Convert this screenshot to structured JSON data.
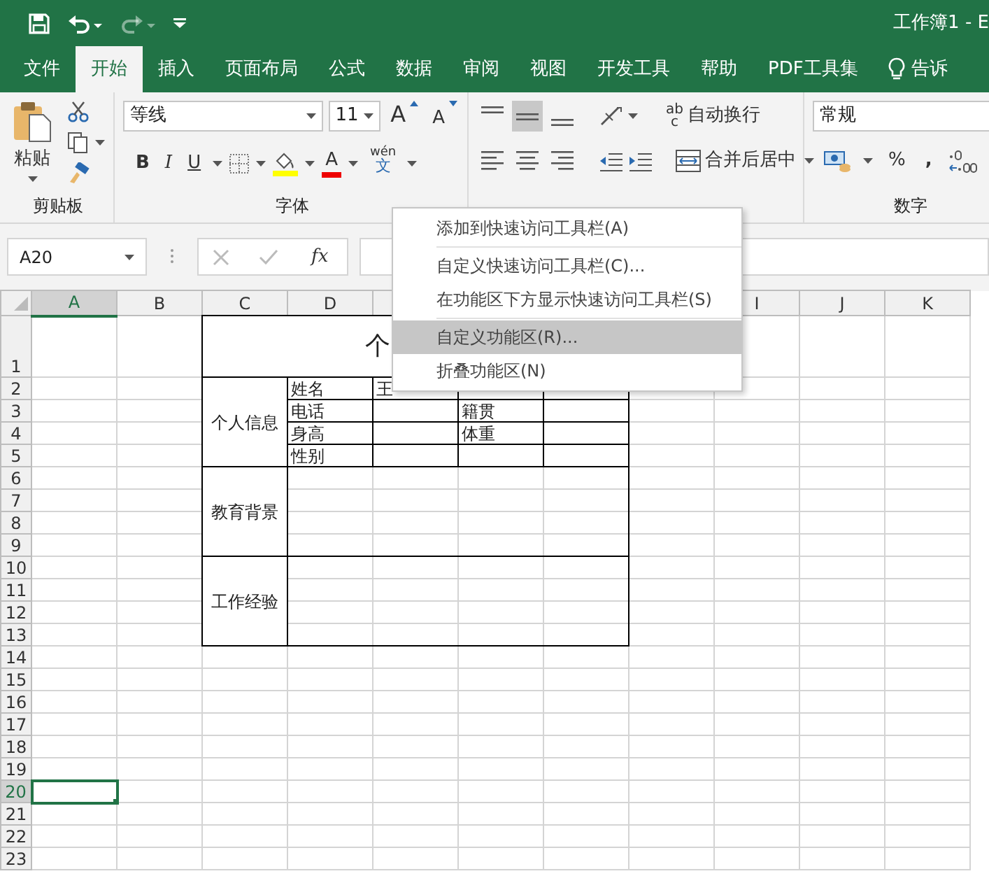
{
  "title_bar": {
    "quick_access": [
      {
        "kind": "save",
        "disabled": false
      },
      {
        "kind": "undo",
        "disabled": false
      },
      {
        "kind": "redo",
        "disabled": true
      },
      {
        "kind": "customize",
        "disabled": false
      }
    ],
    "title": "工作簿1 - E"
  },
  "tabs": [
    {
      "label": "文件",
      "selected": false
    },
    {
      "label": "开始",
      "selected": true
    },
    {
      "label": "插入",
      "selected": false
    },
    {
      "label": "页面布局",
      "selected": false
    },
    {
      "label": "公式",
      "selected": false
    },
    {
      "label": "数据",
      "selected": false
    },
    {
      "label": "审阅",
      "selected": false
    },
    {
      "label": "视图",
      "selected": false
    },
    {
      "label": "开发工具",
      "selected": false
    },
    {
      "label": "帮助",
      "selected": false
    },
    {
      "label": "PDF工具集",
      "selected": false
    },
    {
      "label": "告诉",
      "selected": false,
      "kind": "tell"
    }
  ],
  "ribbon": {
    "clipboard": {
      "paste": "粘贴",
      "label": "剪贴板"
    },
    "font": {
      "family": "等线",
      "size": "11",
      "grow": "A",
      "shrink": "A",
      "bold": "B",
      "italic": "I",
      "underline": "U",
      "font_color": "A",
      "phonetic_top": "wén",
      "phonetic_bottom": "文",
      "label": "字体"
    },
    "alignment": {
      "vertical": [
        {
          "kind": "top",
          "selected": false
        },
        {
          "kind": "middle",
          "selected": true
        },
        {
          "kind": "bottom",
          "selected": false
        }
      ],
      "horizontal": [
        {
          "kind": "left",
          "selected": false
        },
        {
          "kind": "center",
          "selected": false
        },
        {
          "kind": "right",
          "selected": false
        }
      ],
      "wrap_icon_top": "ab",
      "wrap_icon_bottom": "c",
      "wrap": "自动换行",
      "merge": "合并后居中"
    },
    "number": {
      "format": "常规",
      "percent": "%",
      "comma": ",",
      "label": "数字"
    }
  },
  "formula_bar": {
    "name_box": "A20",
    "function": "fx"
  },
  "sheet": {
    "columns": [
      {
        "label": "A",
        "selected": true
      },
      {
        "label": "B",
        "selected": false
      },
      {
        "label": "C",
        "selected": false
      },
      {
        "label": "D",
        "selected": false
      },
      {},
      {},
      {},
      {},
      {
        "label": "I",
        "selected": false
      },
      {
        "label": "J",
        "selected": false
      },
      {
        "label": "K",
        "selected": false
      }
    ],
    "rows": [
      {
        "label": "1",
        "selected": false
      },
      {
        "label": "2",
        "selected": false
      },
      {
        "label": "3",
        "selected": false
      },
      {
        "label": "4",
        "selected": false
      },
      {
        "label": "5",
        "selected": false
      },
      {
        "label": "6",
        "selected": false
      },
      {
        "label": "7",
        "selected": false
      },
      {
        "label": "8",
        "selected": false
      },
      {
        "label": "9",
        "selected": false
      },
      {
        "label": "10",
        "selected": false
      },
      {
        "label": "11",
        "selected": false
      },
      {
        "label": "12",
        "selected": false
      },
      {
        "label": "13",
        "selected": false
      },
      {
        "label": "14",
        "selected": false
      },
      {
        "label": "15",
        "selected": false
      },
      {
        "label": "16",
        "selected": false
      },
      {
        "label": "17",
        "selected": false
      },
      {
        "label": "18",
        "selected": false
      },
      {
        "label": "19",
        "selected": false
      },
      {
        "label": "20",
        "selected": true
      },
      {
        "label": "21",
        "selected": false
      },
      {
        "label": "22",
        "selected": false
      },
      {
        "label": "23",
        "selected": false
      }
    ],
    "form": {
      "title": "个",
      "sections": [
        {
          "label": "个人信息",
          "fields": [
            {
              "label": "姓名",
              "value": "王"
            },
            {
              "label": "电话",
              "label_2": "籍贯"
            },
            {
              "label": "身高",
              "label_2": "体重"
            },
            {
              "label": "性别"
            }
          ]
        },
        {
          "label": "教育背景"
        },
        {
          "label": "工作经验"
        }
      ]
    }
  },
  "context_menu": [
    {
      "kind": "item",
      "label": "添加到快速访问工具栏(A)",
      "selected": false
    },
    {
      "kind": "separator"
    },
    {
      "kind": "item",
      "label": "自定义快速访问工具栏(C)...",
      "selected": false
    },
    {
      "kind": "item",
      "label": "在功能区下方显示快速访问工具栏(S)",
      "selected": false
    },
    {
      "kind": "separator"
    },
    {
      "kind": "item",
      "label": "自定义功能区(R)...",
      "selected": true
    },
    {
      "kind": "item",
      "label": "折叠功能区(N)",
      "selected": false
    }
  ]
}
